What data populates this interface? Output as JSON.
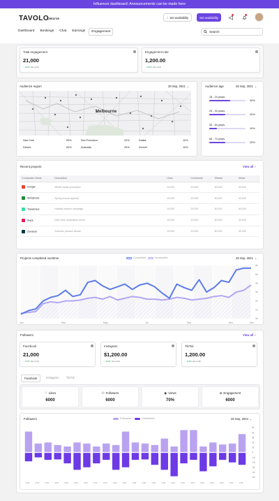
{
  "banner": "Influencer dashboard: Announcements can be made here",
  "brand": {
    "name": "TAVOLO",
    "sub": "CREATOR"
  },
  "header": {
    "set_availability_outline": "Set availability",
    "set_availability_solid": "Set availability",
    "search_placeholder": "Search"
  },
  "nav": [
    "Dashboard",
    "Bookings",
    "Chat",
    "Earnings",
    "Engagement"
  ],
  "kpis": [
    {
      "title": "Total engagement",
      "value": "21,000",
      "delta": "40.8%",
      "delta_note": "last month"
    },
    {
      "title": "Engagement rate",
      "value": "1,200.00",
      "delta": "40.8%",
      "delta_note": "last month"
    }
  ],
  "audience_region": {
    "title": "Audience region",
    "date": "28 Sep, 2021",
    "map_label": "Melbourne",
    "rows": [
      [
        {
          "city": "New York",
          "pct": "50%"
        },
        {
          "city": "San Francisco",
          "pct": "20%"
        },
        {
          "city": "Dallas",
          "pct": "10%"
        }
      ],
      [
        {
          "city": "Detroit",
          "pct": "50%"
        },
        {
          "city": "Australia",
          "pct": "20%"
        },
        {
          "city": "Denver",
          "pct": "10%"
        }
      ]
    ]
  },
  "audience_age": {
    "title": "Audience age",
    "date": "26 Sep, 2021",
    "groups": [
      {
        "label": "18 - 24 years",
        "pct": "30%",
        "fill": 0.58
      },
      {
        "label": "25 - 34 years",
        "pct": "20%",
        "fill": 0.45
      },
      {
        "label": "35 - 54 years",
        "pct": "10%",
        "fill": 0.22
      },
      {
        "label": "55 - 74 years",
        "pct": "20%",
        "fill": 0.45
      }
    ]
  },
  "recent_projects": {
    "title": "Recent projects",
    "view_all": "View all",
    "columns": [
      "Companies Name",
      "Description",
      "Likes",
      "Comments",
      "Shares",
      "Views"
    ],
    "rows": [
      {
        "company": "Google",
        "logo_color": "#ea4335",
        "description": "Winter treats promotion",
        "likes": "10,000",
        "comments": "20,000",
        "shares": "50,000",
        "views": "40,000"
      },
      {
        "company": "Wordpress",
        "logo_color": "#1b8a3c",
        "description": "Spring brunch special",
        "likes": "10,000",
        "comments": "20,000",
        "shares": "50,000",
        "views": "40,000"
      },
      {
        "company": "Tripadvisor",
        "logo_color": "#34e0a1",
        "description": "Holiday season campaign",
        "likes": "10,000",
        "comments": "20,000",
        "shares": "50,000",
        "views": "40,000"
      },
      {
        "company": "Slack",
        "logo_color": "#e01e5a",
        "description": "New Year celebration event",
        "likes": "10,000",
        "comments": "20,000",
        "shares": "50,000",
        "views": "40,000"
      },
      {
        "company": "Zendesk",
        "logo_color": "#03363d",
        "description": "Summer product launch",
        "likes": "10,000",
        "comments": "20,000",
        "shares": "50,000",
        "views": "40,000"
      }
    ]
  },
  "projects_chart": {
    "title": "Projects completed overtime",
    "date": "26 Sep, 2021",
    "legend_completed": "Completed",
    "legend_incomplete": "Incomplete",
    "color_completed": "#5b7be8",
    "color_incomplete": "#b3a6f3"
  },
  "followers": {
    "title": "Followers",
    "view_all": "View all",
    "cards": [
      {
        "title": "Facebook",
        "value": "21,000",
        "delta": "40.8%",
        "delta_note": "last month"
      },
      {
        "title": "Instagram",
        "value": "$1,200.00",
        "delta": "40.8%",
        "delta_note": "last month"
      },
      {
        "title": "TikTok",
        "value": "1,200.00",
        "delta": "40.8%",
        "delta_note": "last month"
      }
    ],
    "tabs": [
      "Facebook",
      "Instagram",
      "TikTok"
    ],
    "stats": [
      {
        "label": "Likes",
        "value": "6000",
        "icon": "heart-icon"
      },
      {
        "label": "Followers",
        "value": "6000",
        "icon": "user-icon"
      },
      {
        "label": "Views",
        "value": "70%",
        "icon": "eye-icon"
      },
      {
        "label": "Engagement",
        "value": "6000",
        "icon": "engagement-icon"
      }
    ]
  },
  "followers_chart": {
    "title": "Followers",
    "date": "26 Sep, 2024",
    "legend_followers": "Followers",
    "legend_unfollowed": "Unfollowed",
    "color_followers": "#b9a3f0",
    "color_unfollowed": "#6d3ae6"
  },
  "chart_data": [
    {
      "type": "line",
      "title": "Projects completed overtime",
      "x_tick_labels": [
        "Jan",
        "Feb",
        "Mar",
        "Apr",
        "May",
        "Jun",
        "Jul",
        "Aug",
        "Sep",
        "Oct",
        "Nov",
        "Dec"
      ],
      "y_tick_labels": [
        "0k",
        "1k",
        "2k",
        "3k",
        "4k",
        "5k",
        "6k"
      ],
      "ylim": [
        0,
        6000
      ],
      "series": [
        {
          "name": "Completed",
          "values": [
            500,
            900,
            1100,
            2000,
            2400,
            2600,
            3200,
            2500,
            2700,
            4100,
            4300,
            3700,
            3300,
            3600,
            3900,
            3300,
            3800,
            4000,
            3600,
            2900,
            2300,
            3900,
            3500,
            3200,
            4400,
            3000,
            3500,
            4300,
            4100,
            5500,
            5700,
            5700
          ]
        },
        {
          "name": "Incomplete",
          "values": [
            600,
            700,
            800,
            1700,
            1900,
            1800,
            2000,
            2000,
            2100,
            2300,
            2400,
            2200,
            2500,
            2100,
            2300,
            2500,
            2400,
            2200,
            2200,
            2100,
            2200,
            2400,
            2300,
            2100,
            2200,
            2300,
            2500,
            2600,
            2400,
            3000,
            3200,
            3800
          ]
        }
      ]
    },
    {
      "type": "bar",
      "title": "Followers",
      "y_tick_labels": [
        "5k",
        "4k",
        "3k",
        "2k",
        "1k",
        "0",
        "-1k",
        "-2k",
        "-3k",
        "-4k",
        "-5k"
      ],
      "ylim": [
        -5000,
        5000
      ],
      "categories": [
        "0:00",
        "0:00",
        "0:00",
        "0:00",
        "0:00",
        "0:00",
        "0:00",
        "0:00",
        "0:00",
        "0:00",
        "0:00",
        "0:00",
        "0:00",
        "0:00",
        "0:00",
        "0:00",
        "0:00",
        "0:00",
        "0:00",
        "0:00",
        "0:00",
        "0:00",
        "0:00"
      ],
      "series": [
        {
          "name": "Followers",
          "values": [
            4200,
            1800,
            2000,
            1500,
            1200,
            2000,
            1800,
            1200,
            1800,
            1500,
            4200,
            2000,
            1800,
            1500,
            2800,
            1200,
            4500,
            4500,
            1200,
            2000,
            1600,
            1800,
            3700
          ]
        },
        {
          "name": "Unfollowed",
          "values": [
            -1800,
            -1000,
            -1500,
            -1400,
            -2200,
            -3500,
            -3000,
            -2200,
            -1500,
            -3500,
            -3000,
            -1500,
            -1400,
            -2500,
            -3500,
            -4800,
            -2200,
            -1500,
            -3800,
            -2800,
            -1500,
            -2000,
            -2500
          ]
        }
      ]
    }
  ]
}
